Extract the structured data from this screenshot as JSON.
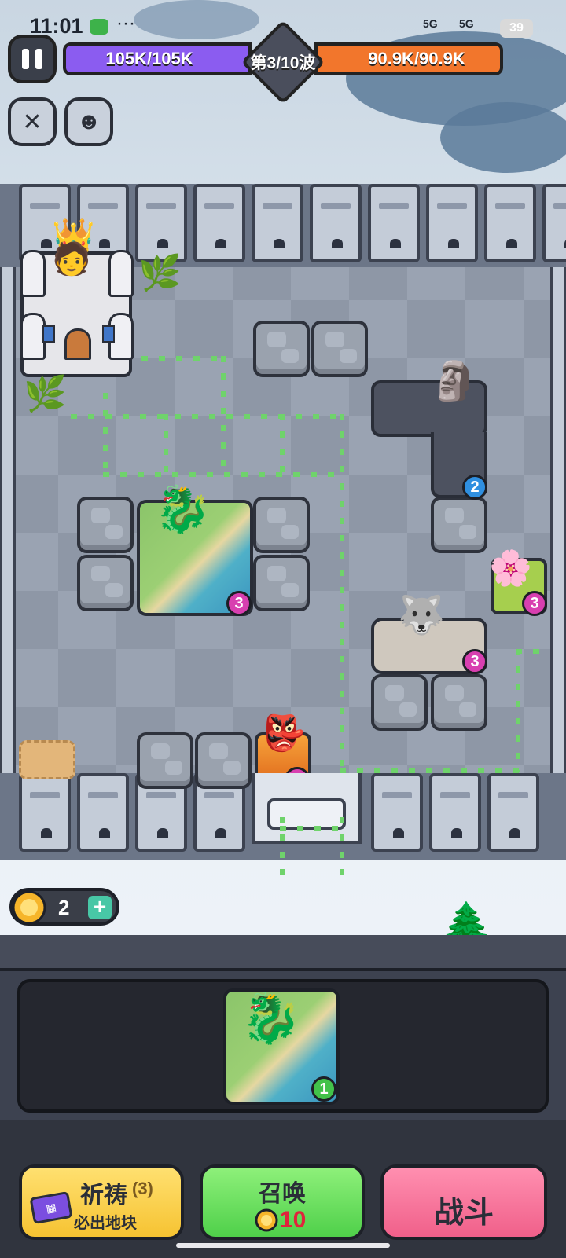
{
  "status_bar": {
    "time": "11:01",
    "dots": "···",
    "signal_1": "5G",
    "signal_2": "5G",
    "battery": "39"
  },
  "hud": {
    "player_hp": "105K/105K",
    "enemy_hp": "90.9K/90.9K",
    "wave": "第3/10波",
    "pause_icon": "pause-icon",
    "skill_icon": "crossed-swords-icon",
    "enemy_icon": "demon-face-icon"
  },
  "board": {
    "tiles": [
      {
        "name": "landscape-tile-dragon",
        "level": "3"
      },
      {
        "name": "dark-rock-tile-golem",
        "level": "2"
      },
      {
        "name": "grass-tile-flowers",
        "level": "3"
      },
      {
        "name": "stone-tile-wolf",
        "level": "3"
      },
      {
        "name": "fire-tile-goblin",
        "level": "3"
      }
    ]
  },
  "resources": {
    "sun_count": "2",
    "plus": "+"
  },
  "hand": {
    "card_level": "1"
  },
  "actions": {
    "pray_label": "祈祷",
    "pray_count": "(3)",
    "pray_sub": "必出地块",
    "summon_label": "召唤",
    "summon_cost": "10",
    "fight_label": "战斗"
  },
  "colors": {
    "player_bar": "#8b5cf0",
    "enemy_bar": "#f2762c",
    "pray_btn": "#f6c332",
    "summon_btn": "#4fd04a",
    "fight_btn": "#f0608a",
    "path": "#6fd36b"
  }
}
